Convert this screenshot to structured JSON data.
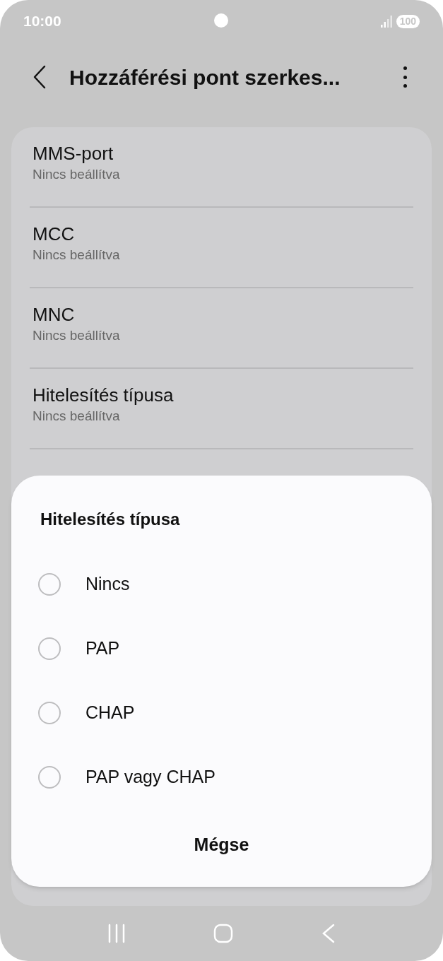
{
  "status_bar": {
    "time": "10:00",
    "battery": "100"
  },
  "header": {
    "title": "Hozzáférési pont szerkes..."
  },
  "settings": [
    {
      "title": "MMS-port",
      "subtitle": "Nincs beállítva"
    },
    {
      "title": "MCC",
      "subtitle": "Nincs beállítva"
    },
    {
      "title": "MNC",
      "subtitle": "Nincs beállítva"
    },
    {
      "title": "Hitelesítés típusa",
      "subtitle": "Nincs beállítva"
    }
  ],
  "dialog": {
    "title": "Hitelesítés típusa",
    "options": [
      {
        "label": "Nincs",
        "selected": false
      },
      {
        "label": "PAP",
        "selected": false
      },
      {
        "label": "CHAP",
        "selected": false
      },
      {
        "label": "PAP vagy CHAP",
        "selected": false
      }
    ],
    "cancel": "Mégse"
  }
}
